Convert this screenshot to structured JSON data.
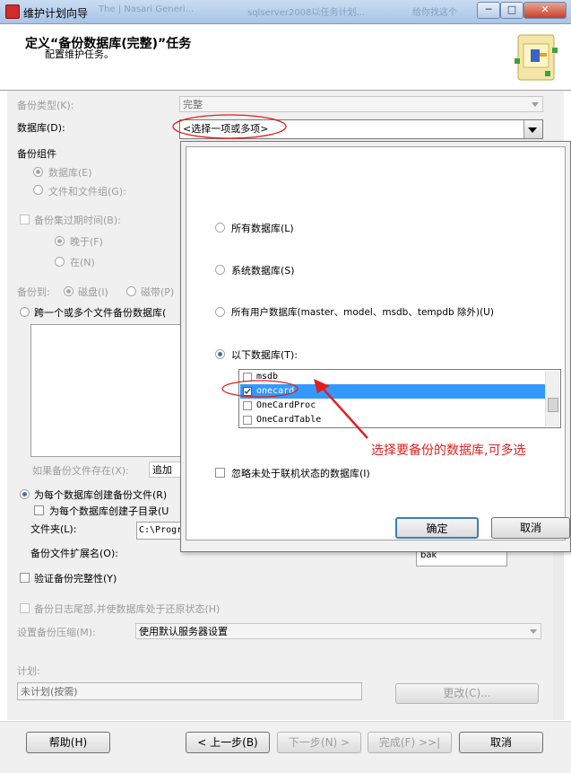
{
  "window": {
    "title": "维护计划向导",
    "taskbar_ghost": [
      "The | Nasari Generi...",
      "sqlserver2008以任务计划...",
      "给你找这个"
    ],
    "minimize": "─",
    "maximize": "□",
    "close": "✕"
  },
  "header": {
    "title": "定义“备份数据库(完整)”任务",
    "subtitle": "配置维护任务。"
  },
  "form": {
    "backup_type_label": "备份类型(K):",
    "backup_type_value": "完整",
    "database_label": "数据库(D):",
    "database_value": "<选择一项或多项>",
    "component_label": "备份组件",
    "component_database": "数据库(E)",
    "component_files": "文件和文件组(G):",
    "expire_label": "备份集过期时间(B):",
    "expire_after": "晚于(F)",
    "expire_on": "在(N)",
    "backup_to_label": "备份到:",
    "backup_to_disk": "磁盘(I)",
    "backup_to_tape": "磁带(P)",
    "span_files": "跨一个或多个文件备份数据库(",
    "if_exists_label": "如果备份文件存在(X):",
    "if_exists_value": "追加",
    "per_db_file": "为每个数据库创建备份文件(R)",
    "per_db_subdir": "为每个数据库创建子目录(U",
    "folder_label": "文件夹(L):",
    "folder_value": "C:\\Progr",
    "ext_label": "备份文件扩展名(O):",
    "ext_value": "bak",
    "verify": "验证备份完整性(Y)",
    "tail_log": "备份日志尾部,并使数据库处于还原状态(H)",
    "compression_label": "设置备份压缩(M):",
    "compression_value": "使用默认服务器设置",
    "schedule_label": "计划:",
    "schedule_value": "未计划(按需)",
    "change_button": "更改(C)..."
  },
  "popup": {
    "all_dbs": "所有数据库(L)",
    "system_dbs": "系统数据库(S)",
    "user_dbs": "所有用户数据库(master、model、msdb、tempdb 除外)(U)",
    "these_dbs": "以下数据库(T):",
    "databases": [
      {
        "name": "msdb",
        "checked": false,
        "selected": false
      },
      {
        "name": "onecard",
        "checked": true,
        "selected": true
      },
      {
        "name": "OneCardProc",
        "checked": false,
        "selected": false
      },
      {
        "name": "OneCardTable",
        "checked": false,
        "selected": false
      }
    ],
    "annotation": "选择要备份的数据库,可多选",
    "ignore_offline": "忽略未处于联机状态的数据库(I)",
    "ok_button": "确定",
    "cancel_button": "取消"
  },
  "footer": {
    "help": "帮助(H)",
    "back": "< 上一步(B)",
    "next": "下一步(N) >",
    "finish": "完成(F) >>|",
    "cancel": "取消"
  },
  "colors": {
    "annotation_red": "#e02020",
    "selection_blue": "#3399ff"
  }
}
